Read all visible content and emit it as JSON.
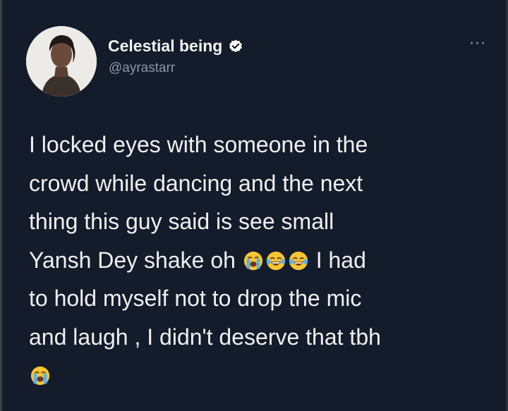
{
  "tweet": {
    "display_name": "Celestial being",
    "handle": "@ayrastarr",
    "more_label": "···",
    "lines": {
      "l1": "I locked eyes with someone in the",
      "l2": "crowd while dancing and the next",
      "l3": "thing this guy said is see small",
      "l4a": "Yansh Dey shake oh ",
      "l4b": " I had",
      "l5": "to hold myself not to drop the mic",
      "l6": "and laugh , I didn't deserve that tbh"
    },
    "emojis": [
      "loudly-crying-face",
      "face-with-tears-of-joy",
      "face-with-tears-of-joy",
      "loudly-crying-face"
    ]
  },
  "colors": {
    "background": "#141b2a",
    "verified_badge": "#ffffff",
    "handle": "#8b98a5",
    "emoji_yellow": "#f7c533"
  }
}
